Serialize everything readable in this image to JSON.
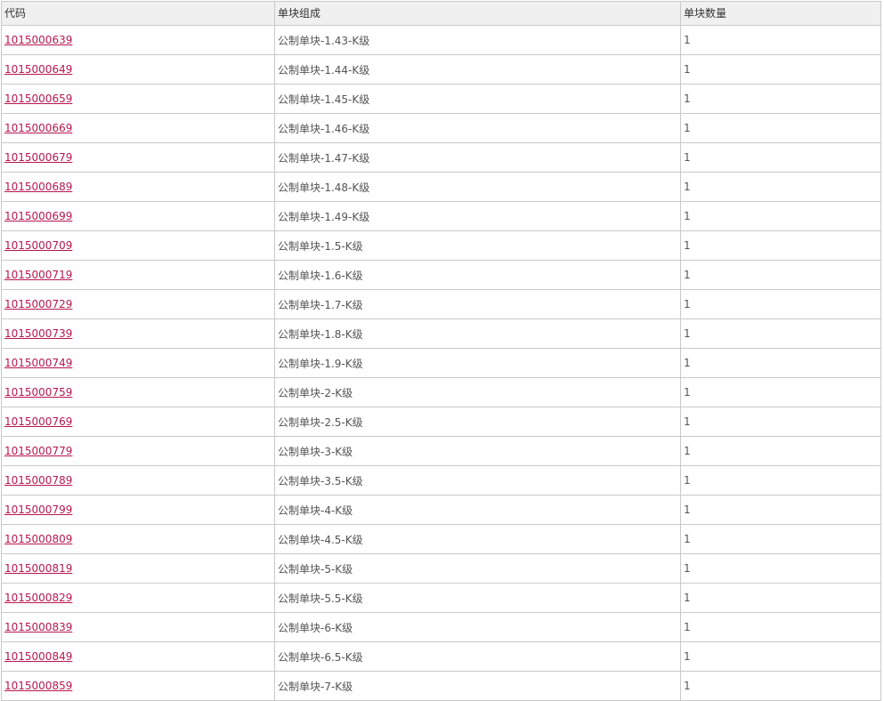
{
  "table": {
    "headers": {
      "code": "代码",
      "composition": "单块组成",
      "quantity": "单块数量"
    },
    "rows": [
      {
        "code": "1015000639",
        "composition": "公制单块-1.43-K级",
        "quantity": "1"
      },
      {
        "code": "1015000649",
        "composition": "公制单块-1.44-K级",
        "quantity": "1"
      },
      {
        "code": "1015000659",
        "composition": "公制单块-1.45-K级",
        "quantity": "1"
      },
      {
        "code": "1015000669",
        "composition": "公制单块-1.46-K级",
        "quantity": "1"
      },
      {
        "code": "1015000679",
        "composition": "公制单块-1.47-K级",
        "quantity": "1"
      },
      {
        "code": "1015000689",
        "composition": "公制单块-1.48-K级",
        "quantity": "1"
      },
      {
        "code": "1015000699",
        "composition": "公制单块-1.49-K级",
        "quantity": "1"
      },
      {
        "code": "1015000709",
        "composition": "公制单块-1.5-K级",
        "quantity": "1"
      },
      {
        "code": "1015000719",
        "composition": "公制单块-1.6-K级",
        "quantity": "1"
      },
      {
        "code": "1015000729",
        "composition": "公制单块-1.7-K级",
        "quantity": "1"
      },
      {
        "code": "1015000739",
        "composition": "公制单块-1.8-K级",
        "quantity": "1"
      },
      {
        "code": "1015000749",
        "composition": "公制单块-1.9-K级",
        "quantity": "1"
      },
      {
        "code": "1015000759",
        "composition": "公制单块-2-K级",
        "quantity": "1"
      },
      {
        "code": "1015000769",
        "composition": "公制单块-2.5-K级",
        "quantity": "1"
      },
      {
        "code": "1015000779",
        "composition": "公制单块-3-K级",
        "quantity": "1"
      },
      {
        "code": "1015000789",
        "composition": "公制单块-3.5-K级",
        "quantity": "1"
      },
      {
        "code": "1015000799",
        "composition": "公制单块-4-K级",
        "quantity": "1"
      },
      {
        "code": "1015000809",
        "composition": "公制单块-4.5-K级",
        "quantity": "1"
      },
      {
        "code": "1015000819",
        "composition": "公制单块-5-K级",
        "quantity": "1"
      },
      {
        "code": "1015000829",
        "composition": "公制单块-5.5-K级",
        "quantity": "1"
      },
      {
        "code": "1015000839",
        "composition": "公制单块-6-K级",
        "quantity": "1"
      },
      {
        "code": "1015000849",
        "composition": "公制单块-6.5-K级",
        "quantity": "1"
      },
      {
        "code": "1015000859",
        "composition": "公制单块-7-K级",
        "quantity": "1"
      }
    ]
  },
  "colors": {
    "link": "#b8174f",
    "header_bg": "#f0f0f0",
    "border": "#c9c9c9",
    "text": "#555555"
  }
}
